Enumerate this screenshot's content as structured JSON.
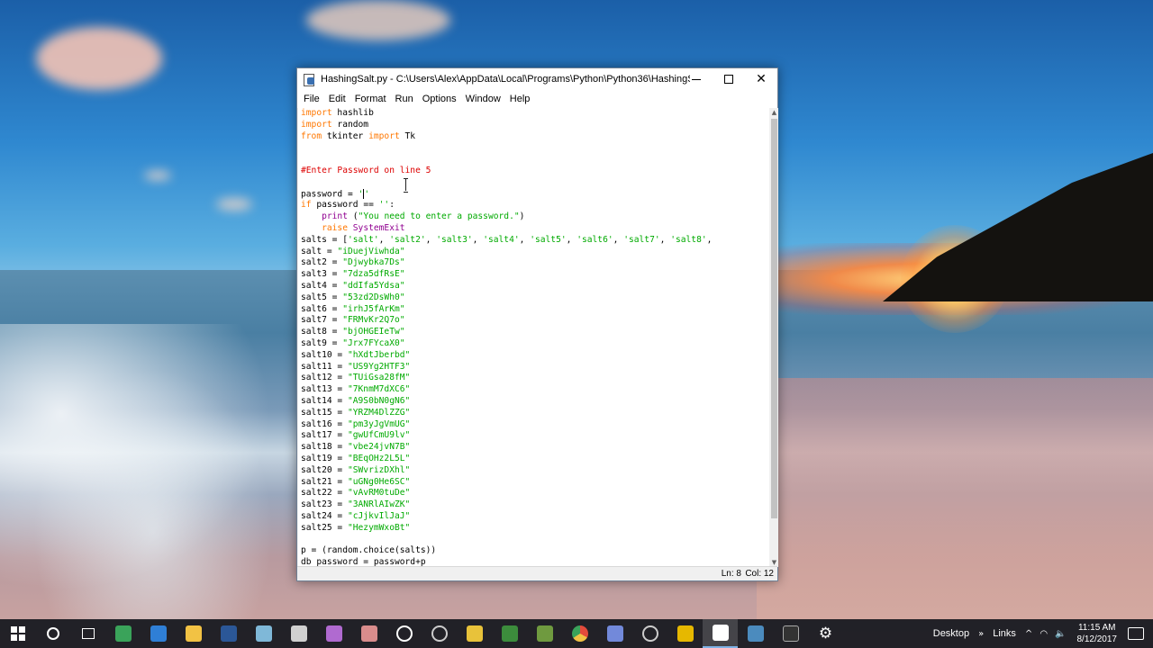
{
  "window": {
    "title": "HashingSalt.py - C:\\Users\\Alex\\AppData\\Local\\Programs\\Python\\Python36\\HashingSalt.py (...",
    "controls": {
      "minimize": "—",
      "maximize": "□",
      "close": "✕"
    }
  },
  "menu": [
    "File",
    "Edit",
    "Format",
    "Run",
    "Options",
    "Window",
    "Help"
  ],
  "code_lines": [
    [
      {
        "t": "import",
        "c": "kw"
      },
      {
        "t": " hashlib",
        "c": "nm"
      }
    ],
    [
      {
        "t": "import",
        "c": "kw"
      },
      {
        "t": " random",
        "c": "nm"
      }
    ],
    [
      {
        "t": "from",
        "c": "kw"
      },
      {
        "t": " tkinter ",
        "c": "nm"
      },
      {
        "t": "import",
        "c": "kw"
      },
      {
        "t": " Tk",
        "c": "nm"
      }
    ],
    [],
    [],
    [
      {
        "t": "#Enter Password on line 5",
        "c": "cmt"
      }
    ],
    [],
    [
      {
        "t": "password = ",
        "c": "nm"
      },
      {
        "t": "'",
        "c": "str"
      },
      {
        "t": "CARET",
        "c": "caret"
      },
      {
        "t": "'",
        "c": "str"
      }
    ],
    [
      {
        "t": "if",
        "c": "kw"
      },
      {
        "t": " password == ",
        "c": "nm"
      },
      {
        "t": "''",
        "c": "str"
      },
      {
        "t": ":",
        "c": "nm"
      }
    ],
    [
      {
        "t": "    ",
        "c": "nm"
      },
      {
        "t": "print",
        "c": "bi"
      },
      {
        "t": " (",
        "c": "nm"
      },
      {
        "t": "\"You need to enter a password.\"",
        "c": "str"
      },
      {
        "t": ")",
        "c": "nm"
      }
    ],
    [
      {
        "t": "    ",
        "c": "nm"
      },
      {
        "t": "raise",
        "c": "kw"
      },
      {
        "t": " ",
        "c": "nm"
      },
      {
        "t": "SystemExit",
        "c": "bi"
      }
    ],
    [
      {
        "t": "salts = [",
        "c": "nm"
      },
      {
        "t": "'salt'",
        "c": "str"
      },
      {
        "t": ", ",
        "c": "nm"
      },
      {
        "t": "'salt2'",
        "c": "str"
      },
      {
        "t": ", ",
        "c": "nm"
      },
      {
        "t": "'salt3'",
        "c": "str"
      },
      {
        "t": ", ",
        "c": "nm"
      },
      {
        "t": "'salt4'",
        "c": "str"
      },
      {
        "t": ", ",
        "c": "nm"
      },
      {
        "t": "'salt5'",
        "c": "str"
      },
      {
        "t": ", ",
        "c": "nm"
      },
      {
        "t": "'salt6'",
        "c": "str"
      },
      {
        "t": ", ",
        "c": "nm"
      },
      {
        "t": "'salt7'",
        "c": "str"
      },
      {
        "t": ", ",
        "c": "nm"
      },
      {
        "t": "'salt8'",
        "c": "str"
      },
      {
        "t": ",",
        "c": "nm"
      }
    ],
    [
      {
        "t": "salt = ",
        "c": "nm"
      },
      {
        "t": "\"iDuejViwhda\"",
        "c": "str"
      }
    ],
    [
      {
        "t": "salt2 = ",
        "c": "nm"
      },
      {
        "t": "\"Djwybka7Ds\"",
        "c": "str"
      }
    ],
    [
      {
        "t": "salt3 = ",
        "c": "nm"
      },
      {
        "t": "\"7dza5dfRsE\"",
        "c": "str"
      }
    ],
    [
      {
        "t": "salt4 = ",
        "c": "nm"
      },
      {
        "t": "\"ddIfa5Ydsa\"",
        "c": "str"
      }
    ],
    [
      {
        "t": "salt5 = ",
        "c": "nm"
      },
      {
        "t": "\"53zd2DsWh0\"",
        "c": "str"
      }
    ],
    [
      {
        "t": "salt6 = ",
        "c": "nm"
      },
      {
        "t": "\"irhJ5fArKm\"",
        "c": "str"
      }
    ],
    [
      {
        "t": "salt7 = ",
        "c": "nm"
      },
      {
        "t": "\"FRMvKr2Q7o\"",
        "c": "str"
      }
    ],
    [
      {
        "t": "salt8 = ",
        "c": "nm"
      },
      {
        "t": "\"bjOHGEIeTw\"",
        "c": "str"
      }
    ],
    [
      {
        "t": "salt9 = ",
        "c": "nm"
      },
      {
        "t": "\"Jrx7FYcaX0\"",
        "c": "str"
      }
    ],
    [
      {
        "t": "salt10 = ",
        "c": "nm"
      },
      {
        "t": "\"hXdtJberbd\"",
        "c": "str"
      }
    ],
    [
      {
        "t": "salt11 = ",
        "c": "nm"
      },
      {
        "t": "\"US9Yg2HTF3\"",
        "c": "str"
      }
    ],
    [
      {
        "t": "salt12 = ",
        "c": "nm"
      },
      {
        "t": "\"TUiGsa28fM\"",
        "c": "str"
      }
    ],
    [
      {
        "t": "salt13 = ",
        "c": "nm"
      },
      {
        "t": "\"7KnmM7dXC6\"",
        "c": "str"
      }
    ],
    [
      {
        "t": "salt14 = ",
        "c": "nm"
      },
      {
        "t": "\"A9S0bN0gN6\"",
        "c": "str"
      }
    ],
    [
      {
        "t": "salt15 = ",
        "c": "nm"
      },
      {
        "t": "\"YRZM4DlZZG\"",
        "c": "str"
      }
    ],
    [
      {
        "t": "salt16 = ",
        "c": "nm"
      },
      {
        "t": "\"pm3yJgVmUG\"",
        "c": "str"
      }
    ],
    [
      {
        "t": "salt17 = ",
        "c": "nm"
      },
      {
        "t": "\"gwUfCmU9lv\"",
        "c": "str"
      }
    ],
    [
      {
        "t": "salt18 = ",
        "c": "nm"
      },
      {
        "t": "\"vbe24jvN7B\"",
        "c": "str"
      }
    ],
    [
      {
        "t": "salt19 = ",
        "c": "nm"
      },
      {
        "t": "\"BEqOHz2L5L\"",
        "c": "str"
      }
    ],
    [
      {
        "t": "salt20 = ",
        "c": "nm"
      },
      {
        "t": "\"SWvrizDXhl\"",
        "c": "str"
      }
    ],
    [
      {
        "t": "salt21 = ",
        "c": "nm"
      },
      {
        "t": "\"uGNg0He6SC\"",
        "c": "str"
      }
    ],
    [
      {
        "t": "salt22 = ",
        "c": "nm"
      },
      {
        "t": "\"vAvRM0tuDe\"",
        "c": "str"
      }
    ],
    [
      {
        "t": "salt23 = ",
        "c": "nm"
      },
      {
        "t": "\"3ANRlAIwZK\"",
        "c": "str"
      }
    ],
    [
      {
        "t": "salt24 = ",
        "c": "nm"
      },
      {
        "t": "\"cJjkvIlJaJ\"",
        "c": "str"
      }
    ],
    [
      {
        "t": "salt25 = ",
        "c": "nm"
      },
      {
        "t": "\"HezymWxoBt\"",
        "c": "str"
      }
    ],
    [],
    [
      {
        "t": "p = (random.choice(salts))",
        "c": "nm"
      }
    ],
    [
      {
        "t": "db_password = password+p",
        "c": "nm"
      }
    ]
  ],
  "status": {
    "line": "Ln: 8",
    "col": "Col: 12"
  },
  "taskbar": {
    "apps": [
      {
        "name": "start",
        "icon": "windows-logo-icon"
      },
      {
        "name": "cortana",
        "icon": "cortana-circle-icon"
      },
      {
        "name": "task-view",
        "icon": "task-view-icon"
      },
      {
        "name": "app-green",
        "icon": "globe-icon",
        "color": "#3aa35a"
      },
      {
        "name": "edge",
        "icon": "edge-icon",
        "color": "#2f7fd6"
      },
      {
        "name": "explorer",
        "icon": "folder-icon",
        "color": "#f2c244"
      },
      {
        "name": "word",
        "icon": "word-icon",
        "color": "#2b5797"
      },
      {
        "name": "app-cube",
        "icon": "cube-icon",
        "color": "#7fb8d8"
      },
      {
        "name": "app-feather",
        "icon": "feather-icon",
        "color": "#d0d0d0"
      },
      {
        "name": "app-balloon",
        "icon": "balloon-icon",
        "color": "#b06ad0"
      },
      {
        "name": "paint",
        "icon": "paint-icon",
        "color": "#d98c8c"
      },
      {
        "name": "app-target",
        "icon": "target-icon",
        "color": "#ffffff"
      },
      {
        "name": "steam",
        "icon": "steam-icon",
        "color": "#cccccc"
      },
      {
        "name": "app-diamond",
        "icon": "diamond-icon",
        "color": "#e8c23a"
      },
      {
        "name": "app-tree",
        "icon": "tree-icon",
        "color": "#3c8c3c"
      },
      {
        "name": "minecraft",
        "icon": "grass-block-icon",
        "color": "#6f9a3f"
      },
      {
        "name": "chrome",
        "icon": "chrome-icon",
        "color": "#e44a3b"
      },
      {
        "name": "discord",
        "icon": "discord-icon",
        "color": "#7289da"
      },
      {
        "name": "app-aperture",
        "icon": "aperture-icon",
        "color": "#cccccc"
      },
      {
        "name": "app-lock",
        "icon": "lock-icon",
        "color": "#e6b800"
      },
      {
        "name": "idle-editor",
        "icon": "python-file-icon",
        "color": "#ffffff",
        "active": true
      },
      {
        "name": "idle-shell",
        "icon": "python-shell-icon",
        "color": "#4b8bbe"
      },
      {
        "name": "terminal",
        "icon": "terminal-icon",
        "color": "#333333"
      },
      {
        "name": "settings",
        "icon": "gear-icon",
        "color": "#ffffff"
      }
    ],
    "tray": {
      "desktop": "Desktop",
      "links": "Links",
      "chevron": "^",
      "time": "11:15 AM",
      "date": "8/12/2017"
    }
  }
}
